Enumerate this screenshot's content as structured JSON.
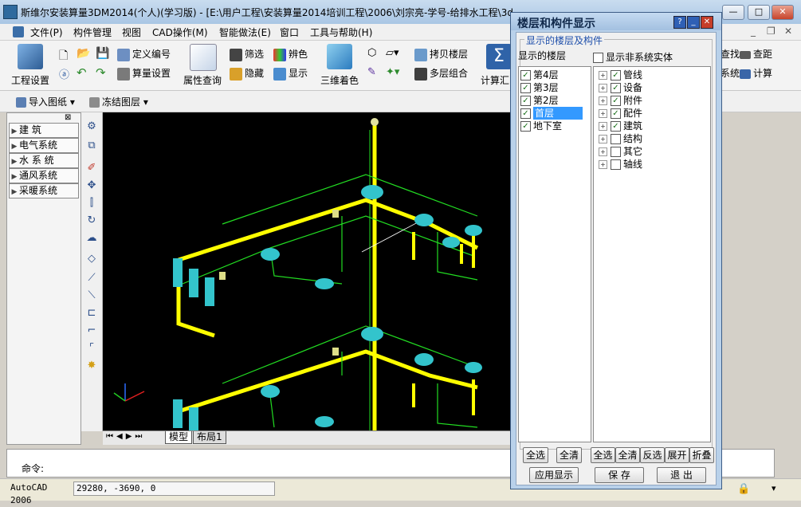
{
  "window": {
    "title": "斯维尔安装算量3DM2014(个人)(学习版) - [E:\\用户工程\\安装算量2014培训工程\\2006\\刘宗亮-学号-给排水工程\\3d",
    "min": "—",
    "max": "□",
    "close": "✕"
  },
  "menu": [
    "文件(P)",
    "构件管理",
    "视图",
    "CAD操作(M)",
    "智能做法(E)",
    "窗口",
    "工具与帮助(H)"
  ],
  "toolbar": {
    "project_setup": "工程设置",
    "define_code": "定义编号",
    "quantity_setup": "算量设置",
    "property_query": "属性查询",
    "filter": "筛选",
    "identify_color": "辨色",
    "hide": "隐藏",
    "display": "显示",
    "render_3d": "三维着色",
    "copy_floor": "拷贝楼层",
    "multi_floor_combine": "多层组合",
    "calc_summary": "计算汇",
    "find": "查找",
    "check_distance": "查距",
    "system": "系统",
    "calculate": "计算"
  },
  "toolbar2": {
    "import_drawing": "导入图纸",
    "freeze_layer": "冻结图层"
  },
  "nav": [
    "建  筑",
    "电气系统",
    "水 系 统",
    "通风系统",
    "采暖系统"
  ],
  "tabs": [
    "模型",
    "布局1"
  ],
  "command": {
    "prompt": "命令:"
  },
  "status": {
    "app": "AutoCAD 2006",
    "coords": "29280, -3690, 0"
  },
  "dialog": {
    "title": "楼层和构件显示",
    "group_label": "显示的楼层及构件",
    "floors_label": "显示的楼层",
    "show_non_system_label": "显示非系统实体",
    "show_non_system_checked": false,
    "floors": [
      {
        "label": "第4层",
        "checked": true,
        "selected": false
      },
      {
        "label": "第3层",
        "checked": true,
        "selected": false
      },
      {
        "label": "第2层",
        "checked": true,
        "selected": false
      },
      {
        "label": "首层",
        "checked": true,
        "selected": true
      },
      {
        "label": "地下室",
        "checked": true,
        "selected": false
      }
    ],
    "components": [
      {
        "label": "管线",
        "checked": true
      },
      {
        "label": "设备",
        "checked": true
      },
      {
        "label": "附件",
        "checked": true
      },
      {
        "label": "配件",
        "checked": true
      },
      {
        "label": "建筑",
        "checked": true
      },
      {
        "label": "结构",
        "checked": false
      },
      {
        "label": "其它",
        "checked": false
      },
      {
        "label": "轴线",
        "checked": false
      }
    ],
    "buttons": {
      "select_all_floors": "全选",
      "clear_floors": "全清",
      "select_all_comp": "全选",
      "clear_comp": "全清",
      "invert": "反选",
      "expand": "展开",
      "collapse": "折叠",
      "apply": "应用显示",
      "save": "保 存",
      "exit": "退 出"
    }
  },
  "colors": {
    "pipe": "#ffff00",
    "frame": "#22dd22",
    "fixture": "#33c4cc",
    "canvas": "#000000"
  }
}
